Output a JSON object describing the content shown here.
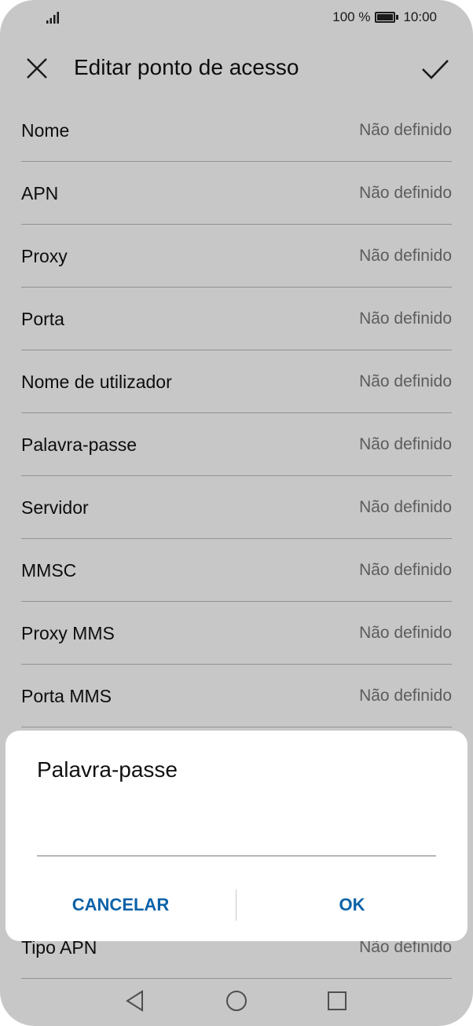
{
  "status_bar": {
    "battery_percent": "100 %",
    "time": "10:00",
    "battery_level": 1.0
  },
  "app_bar": {
    "title": "Editar ponto de acesso",
    "close_icon": "close-icon",
    "confirm_icon": "check-icon"
  },
  "settings": {
    "items": [
      {
        "label": "Nome",
        "value": "Não definido"
      },
      {
        "label": "APN",
        "value": "Não definido"
      },
      {
        "label": "Proxy",
        "value": "Não definido"
      },
      {
        "label": "Porta",
        "value": "Não definido"
      },
      {
        "label": "Nome de utilizador",
        "value": "Não definido"
      },
      {
        "label": "Palavra-passe",
        "value": "Não definido"
      },
      {
        "label": "Servidor",
        "value": "Não definido"
      },
      {
        "label": "MMSC",
        "value": "Não definido"
      },
      {
        "label": "Proxy MMS",
        "value": "Não definido"
      },
      {
        "label": "Porta MMS",
        "value": "Não definido"
      },
      {
        "label": "",
        "value": ""
      },
      {
        "label": "",
        "value": ""
      },
      {
        "label": "",
        "value": ""
      },
      {
        "label": "Tipo APN",
        "value": "Não definido"
      }
    ]
  },
  "dialog": {
    "title": "Palavra-passe",
    "input_value": "",
    "cancel_label": "CANCELAR",
    "ok_label": "OK"
  },
  "nav_bar": {
    "back_icon": "back-triangle-icon",
    "home_icon": "home-circle-icon",
    "recents_icon": "recents-square-icon"
  },
  "colors": {
    "accent": "#0b62a8",
    "dim_overlay": "rgba(0,0,0,0.22)"
  }
}
